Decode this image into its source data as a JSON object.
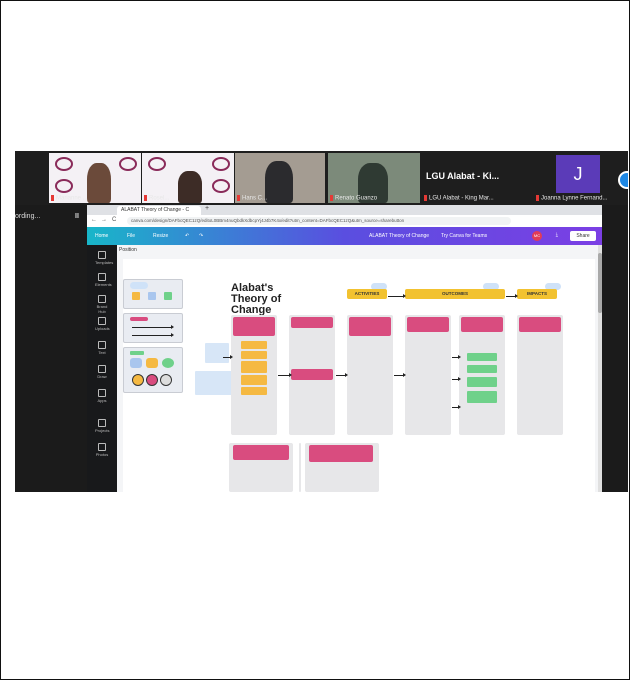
{
  "participants": [
    {
      "name": "Marianne ...",
      "muted": true
    },
    {
      "name": "Rosel...",
      "muted": true
    },
    {
      "name": "Hans C...",
      "muted": true
    },
    {
      "name": "Renato Guanzo",
      "muted": true
    },
    {
      "name": "LGU Alabat - Ki...",
      "subname": "LGU Alabat - King Mar...",
      "muted": true
    },
    {
      "name": "Joanna Lynne Fernand...",
      "initial": "J",
      "muted": true
    }
  ],
  "recording": {
    "label": "ording...",
    "pause": "II"
  },
  "browser": {
    "tab_title": "ALABAT Theory of Change - C",
    "new_tab": "+",
    "url": "canva.com/design/DAFbcQEC1zQ/editoL0BBm4nuQbdkXdbcpYj4J4b7K4x/edit?utm_content=DAFbcQEC1zQ&utm_source=sharebutton",
    "nav_back": "←",
    "nav_forward": "→",
    "reload": "C"
  },
  "canva": {
    "home": "Home",
    "file": "File",
    "resize": "Resize",
    "doc_title": "ALABAT Theory of Change",
    "try_teams": "Try Canva for Teams",
    "avatar": "MC",
    "share": "Share",
    "position_label": "Position",
    "tools": [
      "Templates",
      "Elements",
      "Brand Hub",
      "Uploads",
      "Text",
      "Draw",
      "Apps",
      "Projects",
      "Photos"
    ]
  },
  "diagram": {
    "title_line1": "Alabat's",
    "title_line2": "Theory of Change",
    "headers": [
      "ACTIVITIES",
      "OUTCOMES",
      "IMPACTS"
    ]
  },
  "colors": {
    "accent_pink": "#d94c7f",
    "accent_yellow": "#f2c230",
    "accent_green": "#6fd18a",
    "canva_gradient_start": "#18b6c9",
    "canva_gradient_end": "#7b3fe4"
  }
}
